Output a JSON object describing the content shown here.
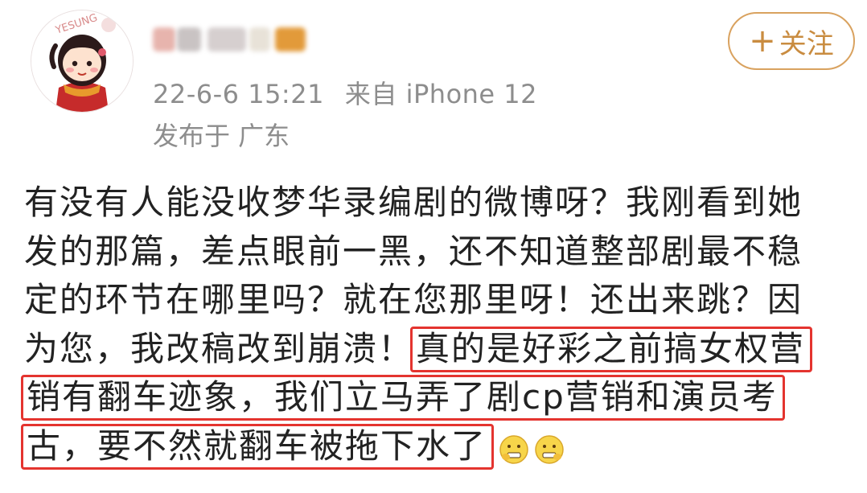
{
  "post": {
    "avatar_label": "YESUNG",
    "username": "",
    "timestamp": "22-6-6 15:21",
    "source": "来自 iPhone 12",
    "region": "发布于 广东",
    "follow_plus": "+",
    "follow_label": "关注",
    "content": {
      "line1": "有没有人能没收梦华录编剧的微博呀？我刚看到她",
      "line2": "发的那篇，差点眼前一黑，还不知道整部剧最不稳",
      "line3": "定的环节在哪里吗？就在您那里呀！还出来跳？因",
      "line4_plain": "为您，我改稿改到崩溃！",
      "line4_highlight": "真的是好彩之前搞女权营",
      "line5_highlight": "销有翻车迹象，我们立马弄了剧cp营销和演员考",
      "line6_highlight": "古，要不然就翻车被拖下水了"
    },
    "emojis": [
      "grimace-emoji",
      "grimace-emoji"
    ]
  },
  "colors": {
    "highlight_border": "#e4342f",
    "follow_accent": "#d9a25f",
    "meta_text": "#8d8d8d"
  }
}
